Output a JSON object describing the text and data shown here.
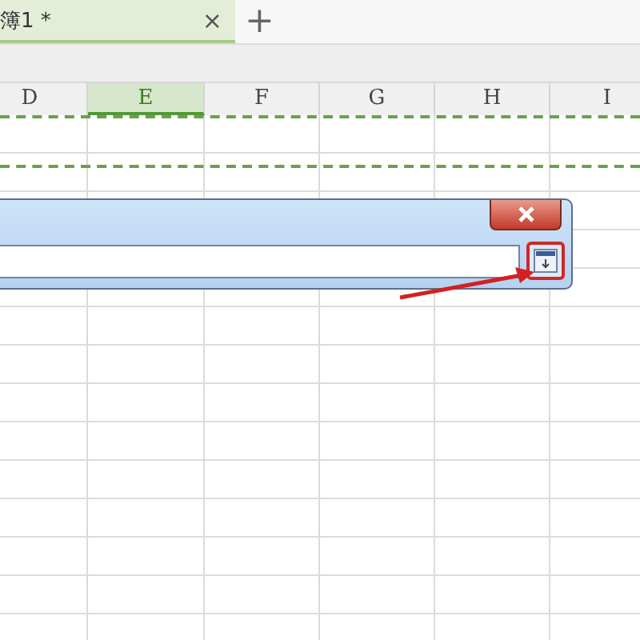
{
  "tabs": [
    {
      "label": "簿1 *",
      "close": "×",
      "selected": true
    }
  ],
  "new_tab": "+",
  "columns": [
    {
      "label": "D",
      "selected": false
    },
    {
      "label": "E",
      "selected": true
    },
    {
      "label": "F",
      "selected": false
    },
    {
      "label": "G",
      "selected": false
    },
    {
      "label": "H",
      "selected": false
    },
    {
      "label": "I",
      "selected": false
    }
  ]
}
